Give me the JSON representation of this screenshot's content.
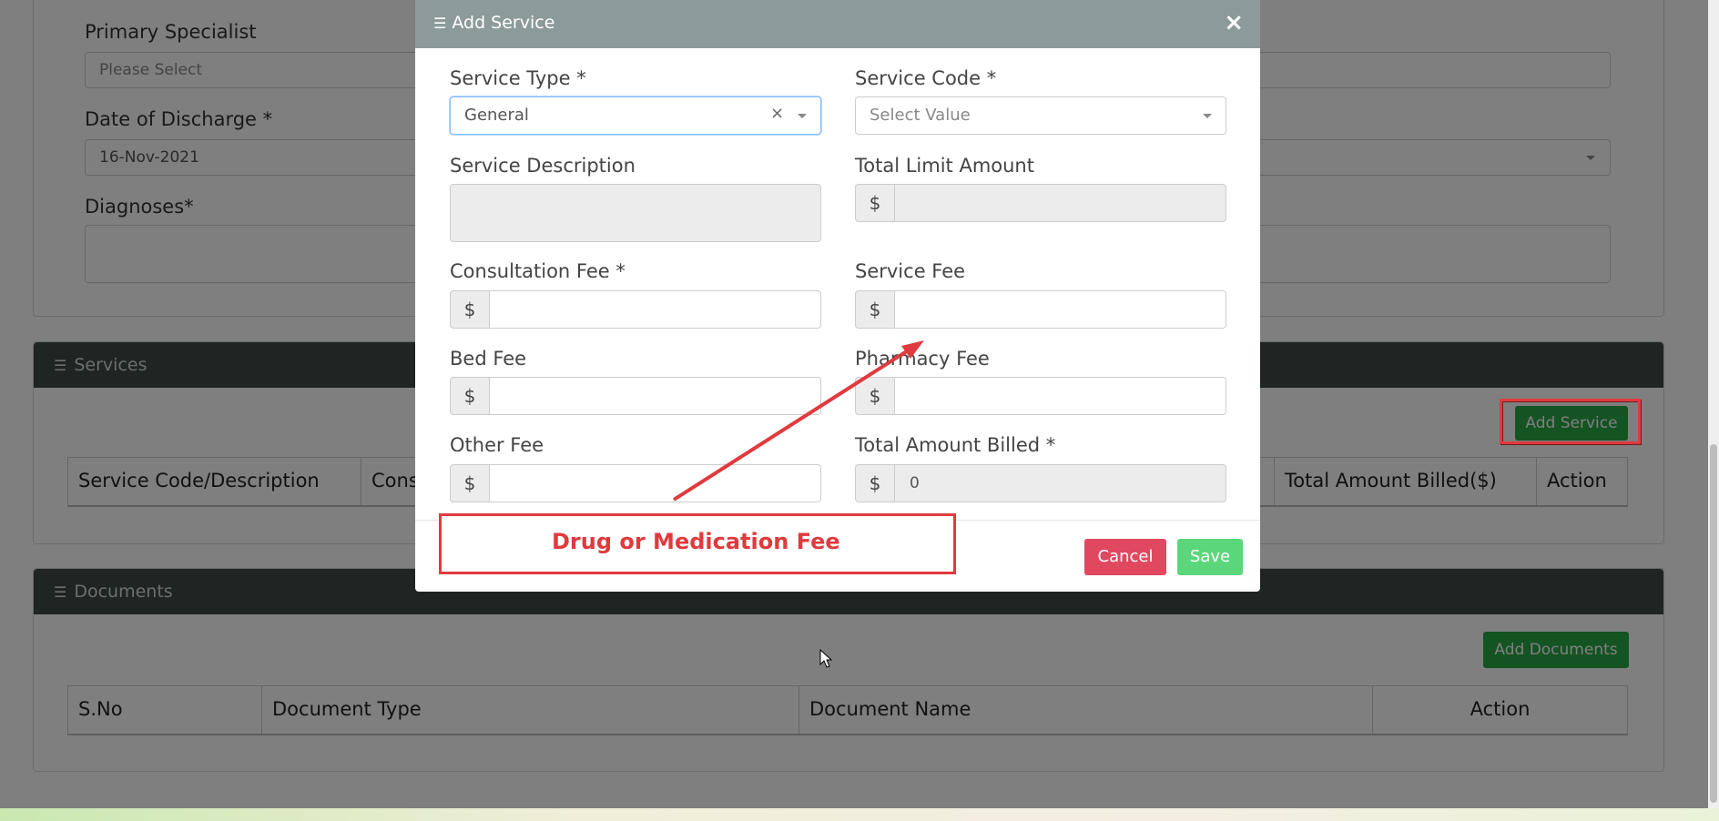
{
  "form": {
    "primary_specialist_label": "Primary Specialist",
    "primary_specialist_placeholder": "Please Select",
    "date_of_discharge_label": "Date of Discharge *",
    "date_of_discharge_value": "16-Nov-2021",
    "diagnoses_label": "Diagnoses*"
  },
  "services": {
    "title": "Services",
    "add_button": "Add Service",
    "columns": [
      "Service Code/Description",
      "Cons",
      "Total Amount Billed($)",
      "Action"
    ]
  },
  "documents": {
    "title": "Documents",
    "add_button": "Add Documents",
    "columns": [
      "S.No",
      "Document Type",
      "Document Name",
      "Action"
    ]
  },
  "modal": {
    "title": "Add Service",
    "close_glyph": "×",
    "service_type_label": "Service Type *",
    "service_type_value": "General",
    "clear_glyph": "×",
    "service_code_label": "Service Code *",
    "service_code_placeholder": "Select Value",
    "service_description_label": "Service Description",
    "total_limit_label": "Total Limit Amount",
    "consultation_fee_label": "Consultation Fee *",
    "service_fee_label": "Service Fee",
    "bed_fee_label": "Bed Fee",
    "pharmacy_fee_label": "Pharmacy Fee",
    "other_fee_label": "Other Fee",
    "total_billed_label": "Total Amount Billed *",
    "total_billed_value": "0",
    "currency": "$",
    "cancel": "Cancel",
    "save": "Save"
  },
  "annotation": {
    "text": "Drug or Medication Fee"
  },
  "colors": {
    "accent_red": "#e03a3e",
    "save_green": "#28a745",
    "cancel_red": "#dc3545",
    "header_dark": "#3c4a46"
  }
}
